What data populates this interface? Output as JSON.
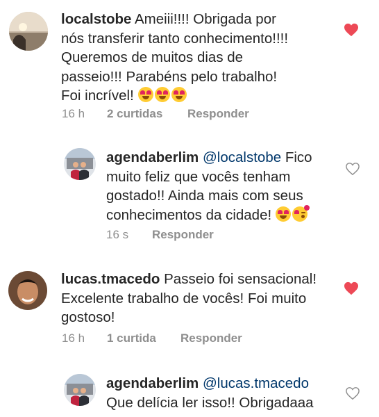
{
  "comments": [
    {
      "username": "localstobe",
      "text": "Ameiii!!!! Obrigada por nós transferir tanto conhecimento!!!! Queremos de muitos dias de passeio!!! Parabéns pelo trabalho! Foi incrível!",
      "emojis": [
        "heart-eyes-icon",
        "heart-eyes-icon",
        "heart-eyes-icon"
      ],
      "time": "16 h",
      "likes": "2 curtidas",
      "reply": "Responder",
      "liked": true
    },
    {
      "username": "agendaberlim",
      "mention": "@localstobe",
      "text": "Fico muito feliz que vocês tenham gostado!! Ainda mais com seus conhecimentos da cidade!",
      "emojis": [
        "heart-eyes-icon",
        "kiss-icon"
      ],
      "time": "16 s",
      "reply": "Responder",
      "liked": false
    },
    {
      "username": "lucas.tmacedo",
      "text": "Passeio foi sensacional! Excelente trabalho de vocês! Foi muito gostoso!",
      "time": "16 h",
      "likes": "1 curtida",
      "reply": "Responder",
      "liked": true
    },
    {
      "username": "agendaberlim",
      "mention": "@lucas.tmacedo",
      "text": "Que delícia ler isso!! Obrigadaaa",
      "liked": false
    }
  ],
  "colors": {
    "liked_heart": "#ed4956",
    "mention": "#00376b",
    "meta": "#8e8e8e"
  }
}
